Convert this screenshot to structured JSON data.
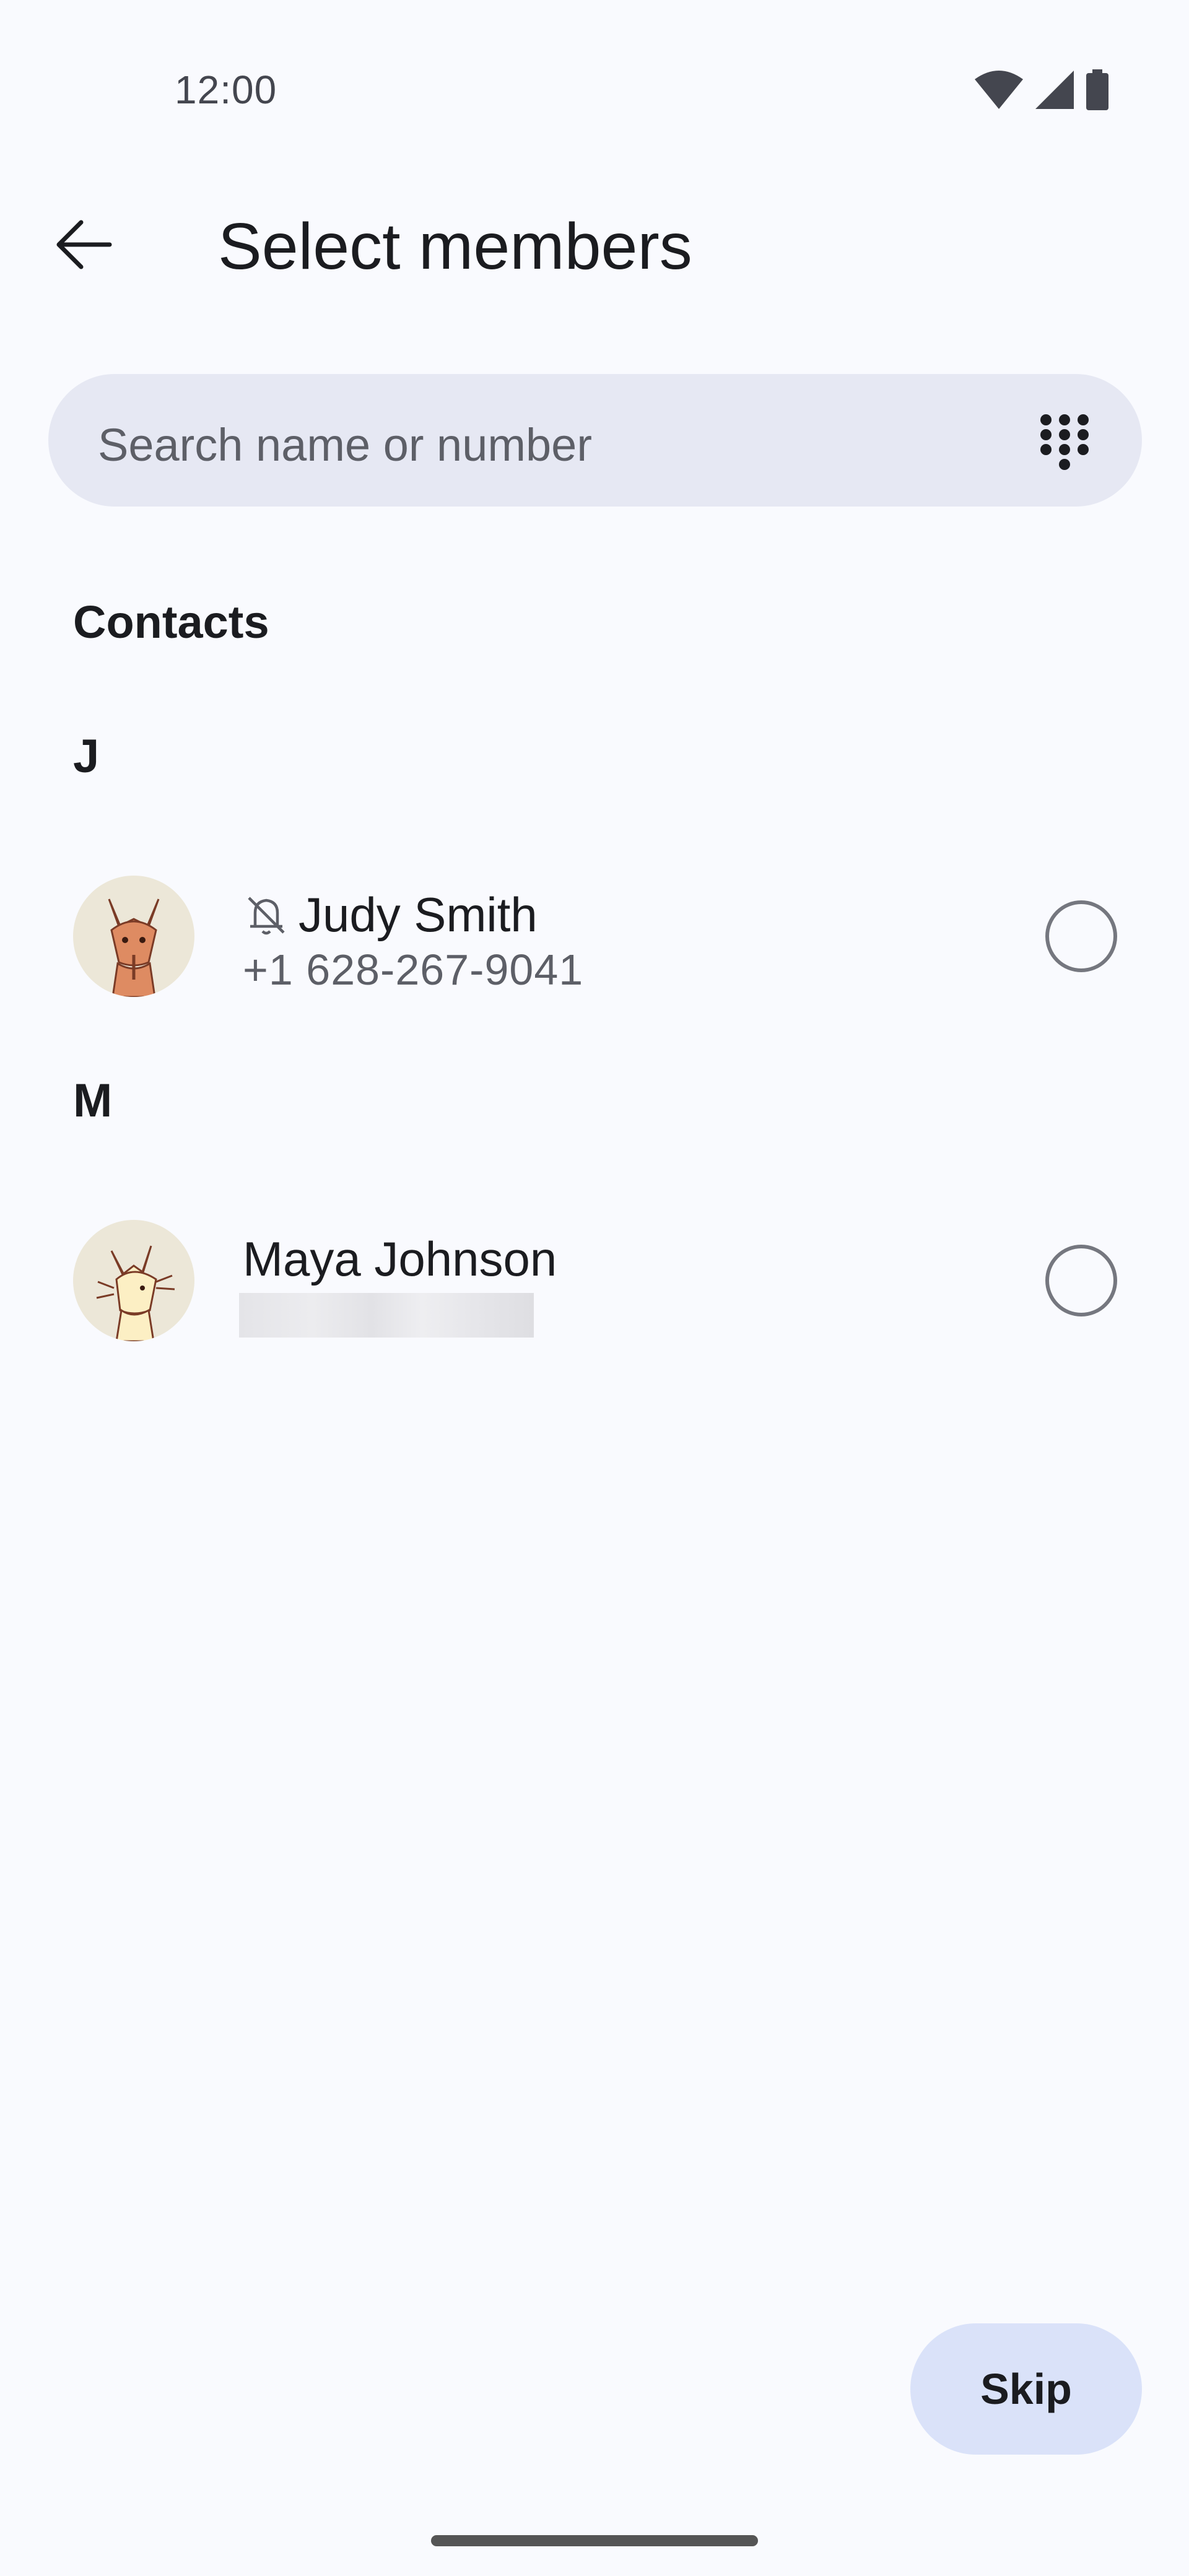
{
  "status_bar": {
    "time": "12:00"
  },
  "app_bar": {
    "title": "Select members"
  },
  "search": {
    "placeholder": "Search name or number"
  },
  "sections": {
    "contacts_label": "Contacts",
    "groups": [
      {
        "letter": "J",
        "contact": {
          "name": "Judy Smith",
          "number": "+1 628-267-9041",
          "muted": true
        }
      },
      {
        "letter": "M",
        "contact": {
          "name": "Maya Johnson",
          "number_redacted": true
        }
      }
    ]
  },
  "skip_label": "Skip",
  "colors": {
    "background": "#f9fafe",
    "search_bg": "#e6e8f3",
    "skip_bg": "#dae2f9"
  }
}
